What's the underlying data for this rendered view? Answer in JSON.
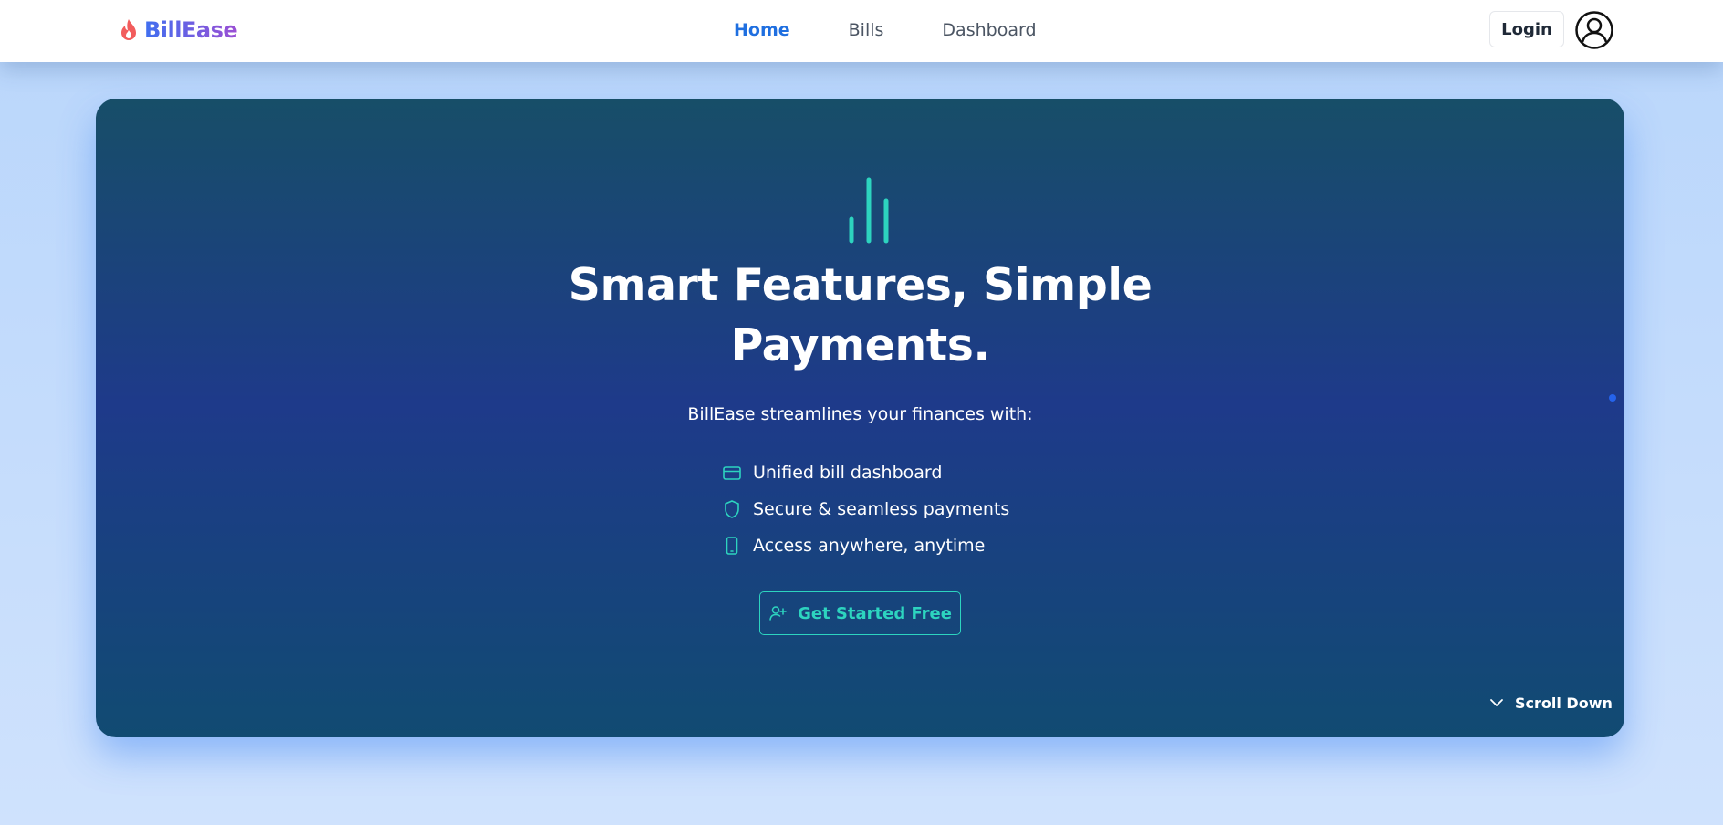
{
  "brand": {
    "name": "BillEase",
    "icon": "flame-icon",
    "gradient": [
      "#3f6ff0",
      "#9b4fd4"
    ],
    "icon_color": "#f25c5c"
  },
  "nav": {
    "items": [
      {
        "label": "Home",
        "active": true
      },
      {
        "label": "Bills",
        "active": false
      },
      {
        "label": "Dashboard",
        "active": false
      }
    ],
    "active_color": "#1f6fe0"
  },
  "header": {
    "login_label": "Login",
    "avatar_icon": "user-circle-icon"
  },
  "hero": {
    "icon": "bar-chart-icon",
    "title_line1": "Smart Features, Simple",
    "title_line2": "Payments.",
    "subtitle": "BillEase streamlines your finances with:",
    "features": [
      {
        "icon": "credit-card-icon",
        "label": "Unified bill dashboard"
      },
      {
        "icon": "shield-icon",
        "label": "Secure & seamless payments"
      },
      {
        "icon": "smartphone-icon",
        "label": "Access anywhere, anytime"
      }
    ],
    "cta": {
      "label": "Get Started Free",
      "icon": "user-plus-icon"
    },
    "scroll_label": "Scroll Down",
    "scroll_icon": "chevron-down-icon",
    "accent_color": "#2dd4bf",
    "gradient": [
      "#174e68",
      "#1e3a8a",
      "#114b72"
    ]
  },
  "pagination": {
    "dot_count": 3,
    "active_index": 1
  }
}
